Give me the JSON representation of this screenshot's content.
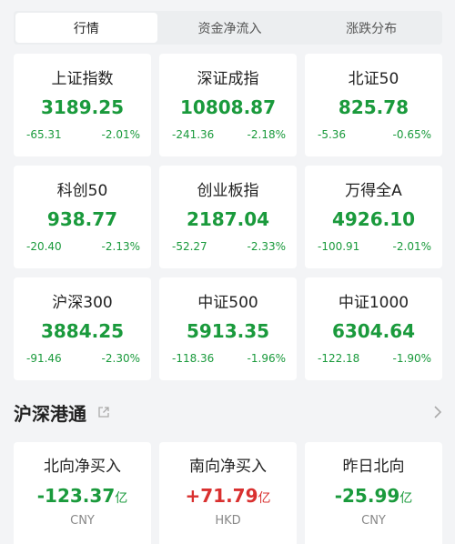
{
  "tabs": [
    {
      "label": "行情",
      "active": true
    },
    {
      "label": "资金净流入",
      "active": false
    },
    {
      "label": "涨跌分布",
      "active": false
    }
  ],
  "indices": [
    {
      "name": "上证指数",
      "value": "3189.25",
      "change": "-65.31",
      "pct": "-2.01%",
      "trend": "down"
    },
    {
      "name": "深证成指",
      "value": "10808.87",
      "change": "-241.36",
      "pct": "-2.18%",
      "trend": "down"
    },
    {
      "name": "北证50",
      "value": "825.78",
      "change": "-5.36",
      "pct": "-0.65%",
      "trend": "down"
    },
    {
      "name": "科创50",
      "value": "938.77",
      "change": "-20.40",
      "pct": "-2.13%",
      "trend": "down"
    },
    {
      "name": "创业板指",
      "value": "2187.04",
      "change": "-52.27",
      "pct": "-2.33%",
      "trend": "down"
    },
    {
      "name": "万得全A",
      "value": "4926.10",
      "change": "-100.91",
      "pct": "-2.01%",
      "trend": "down"
    },
    {
      "name": "沪深300",
      "value": "3884.25",
      "change": "-91.46",
      "pct": "-2.30%",
      "trend": "down"
    },
    {
      "name": "中证500",
      "value": "5913.35",
      "change": "-118.36",
      "pct": "-1.96%",
      "trend": "down"
    },
    {
      "name": "中证1000",
      "value": "6304.64",
      "change": "-122.18",
      "pct": "-1.90%",
      "trend": "down"
    }
  ],
  "connect": {
    "title": "沪深港通",
    "share_icon": "share-icon",
    "more_icon": "chevron-right-icon",
    "cards": [
      {
        "name": "北向净买入",
        "value": "-123.37",
        "unit": "亿",
        "currency": "CNY",
        "trend": "down"
      },
      {
        "name": "南向净买入",
        "value": "+71.79",
        "unit": "亿",
        "currency": "HKD",
        "trend": "up"
      },
      {
        "name": "昨日北向",
        "value": "-25.99",
        "unit": "亿",
        "currency": "CNY",
        "trend": "down"
      }
    ]
  },
  "colors": {
    "down": "#1a9a3c",
    "up": "#d9302f",
    "background": "#f3f4f6"
  }
}
